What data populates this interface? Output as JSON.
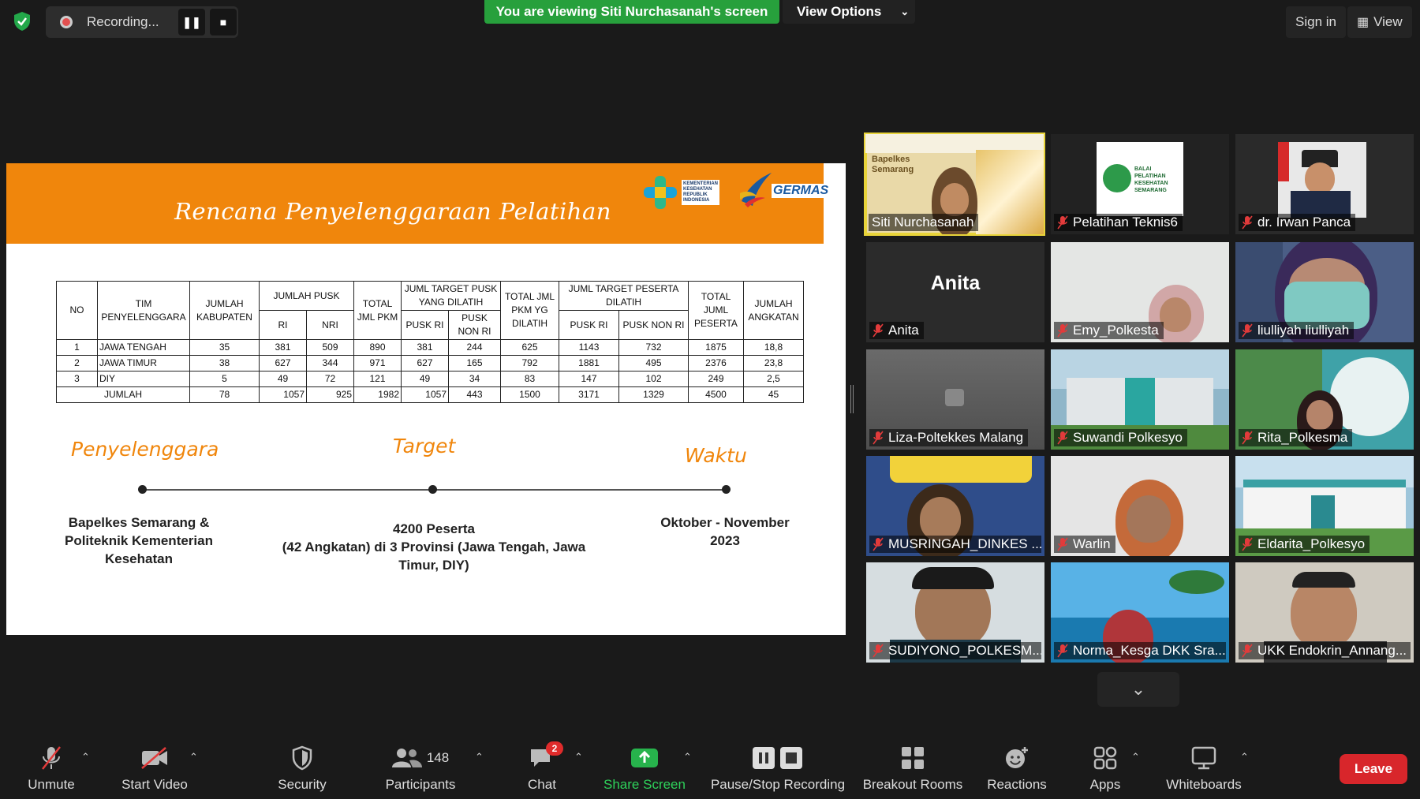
{
  "top": {
    "recording_label": "Recording...",
    "viewing_label": "You are viewing Siti Nurchasanah's screen",
    "view_options_label": "View Options",
    "sign_in_label": "Sign in",
    "view_label": "View"
  },
  "slide": {
    "title": "Rencana Penyelenggaraan Pelatihan",
    "logo_kemenkes": "KEMENTERIAN KESEHATAN REPUBLIK INDONESIA",
    "logo_germas": "GERMAS",
    "table": {
      "h_no": "NO",
      "h_tim": "TIM PENYELENGGARA",
      "h_kab": "JUMLAH KABUPATEN",
      "h_pusk": "JUMLAH PUSK",
      "h_ri": "RI",
      "h_nri": "NRI",
      "h_total_pkm": "TOTAL JML PKM",
      "h_target_pusk": "JUML TARGET PUSK YANG DILATIH",
      "h_pusk_ri": "PUSK RI",
      "h_pusk_non_ri": "PUSK NON RI",
      "h_total_dilatih": "TOTAL JML PKM YG DILATIH",
      "h_target_peserta": "JUML TARGET PESERTA DILATIH",
      "h_peserta_ri": "PUSK RI",
      "h_peserta_non_ri": "PUSK NON RI",
      "h_total_peserta": "TOTAL JUML PESERTA",
      "h_angkatan": "JUMLAH ANGKATAN",
      "rows": [
        {
          "no": "1",
          "tim": "JAWA TENGAH",
          "kab": "35",
          "ri": "381",
          "nri": "509",
          "total_pkm": "890",
          "pusk_ri": "381",
          "pusk_non_ri": "244",
          "total_dilatih": "625",
          "peserta_ri": "1143",
          "peserta_non_ri": "732",
          "total_peserta": "1875",
          "angkatan": "18,8"
        },
        {
          "no": "2",
          "tim": "JAWA TIMUR",
          "kab": "38",
          "ri": "627",
          "nri": "344",
          "total_pkm": "971",
          "pusk_ri": "627",
          "pusk_non_ri": "165",
          "total_dilatih": "792",
          "peserta_ri": "1881",
          "peserta_non_ri": "495",
          "total_peserta": "2376",
          "angkatan": "23,8"
        },
        {
          "no": "3",
          "tim": "DIY",
          "kab": "5",
          "ri": "49",
          "nri": "72",
          "total_pkm": "121",
          "pusk_ri": "49",
          "pusk_non_ri": "34",
          "total_dilatih": "83",
          "peserta_ri": "147",
          "peserta_non_ri": "102",
          "total_peserta": "249",
          "angkatan": "2,5"
        }
      ],
      "total": {
        "label": "JUMLAH",
        "kab": "78",
        "ri": "1057",
        "nri": "925",
        "total_pkm": "1982",
        "pusk_ri": "1057",
        "pusk_non_ri": "443",
        "total_dilatih": "1500",
        "peserta_ri": "3171",
        "peserta_non_ri": "1329",
        "total_peserta": "4500",
        "angkatan": "45"
      }
    },
    "col1_label": "Penyelenggara",
    "col2_label": "Target",
    "col3_label": "Waktu",
    "col1_text": "Bapelkes Semarang & Politeknik Kementerian Kesehatan",
    "col2_line1": "4200 Peserta",
    "col2_line2": "(42 Angkatan) di 3 Provinsi (Jawa Tengah, Jawa Timur, DIY)",
    "col3_text": "Oktober - November 2023"
  },
  "participants": [
    {
      "name": "Siti Nurchasanah",
      "muted": false,
      "active": true,
      "bg": "#e9d9a8"
    },
    {
      "name": "Pelatihan Teknis6",
      "muted": true,
      "bg": "#222222"
    },
    {
      "name": "dr. Irwan Panca",
      "muted": true,
      "bg": "#2a2a2a"
    },
    {
      "name": "Anita",
      "muted": true,
      "bg": "#2b2b2b",
      "big": "Anita"
    },
    {
      "name": "Emy_Polkesta",
      "muted": true,
      "bg": "#e4e6e4"
    },
    {
      "name": "liulliyah liulliyah",
      "muted": true,
      "bg": "#4b5e86"
    },
    {
      "name": "Liza-Poltekkes Malang",
      "muted": true,
      "bg": "#5a5a5a"
    },
    {
      "name": "Suwandi Polkesyo",
      "muted": true,
      "bg": "#8fb6c9"
    },
    {
      "name": "Rita_Polkesma",
      "muted": true,
      "bg": "#3fa2a8"
    },
    {
      "name": "MUSRINGAH_DINKES ...",
      "muted": true,
      "bg": "#2f4d8a"
    },
    {
      "name": "Warlin",
      "muted": true,
      "bg": "#e5e5e5"
    },
    {
      "name": "Eldarita_Polkesyo",
      "muted": true,
      "bg": "#9ec5da"
    },
    {
      "name": "SUDIYONO_POLKESM...",
      "muted": true,
      "bg": "#d6dde0"
    },
    {
      "name": "Norma_Kesga DKK Sra...",
      "muted": true,
      "bg": "#2e8fc8"
    },
    {
      "name": "UKK Endokrin_Annang...",
      "muted": true,
      "bg": "#cfcac0"
    }
  ],
  "toolbar": {
    "unmute": "Unmute",
    "start_video": "Start Video",
    "security": "Security",
    "participants": "Participants",
    "participants_count": "148",
    "chat": "Chat",
    "chat_badge": "2",
    "share_screen": "Share Screen",
    "pause_stop": "Pause/Stop Recording",
    "breakout": "Breakout Rooms",
    "reactions": "Reactions",
    "apps": "Apps",
    "whiteboards": "Whiteboards",
    "leave": "Leave"
  },
  "colors": {
    "accent_green": "#27a03c",
    "slide_orange": "#f0860c",
    "leave_red": "#d8262b",
    "active_outline": "#e8d43a"
  }
}
